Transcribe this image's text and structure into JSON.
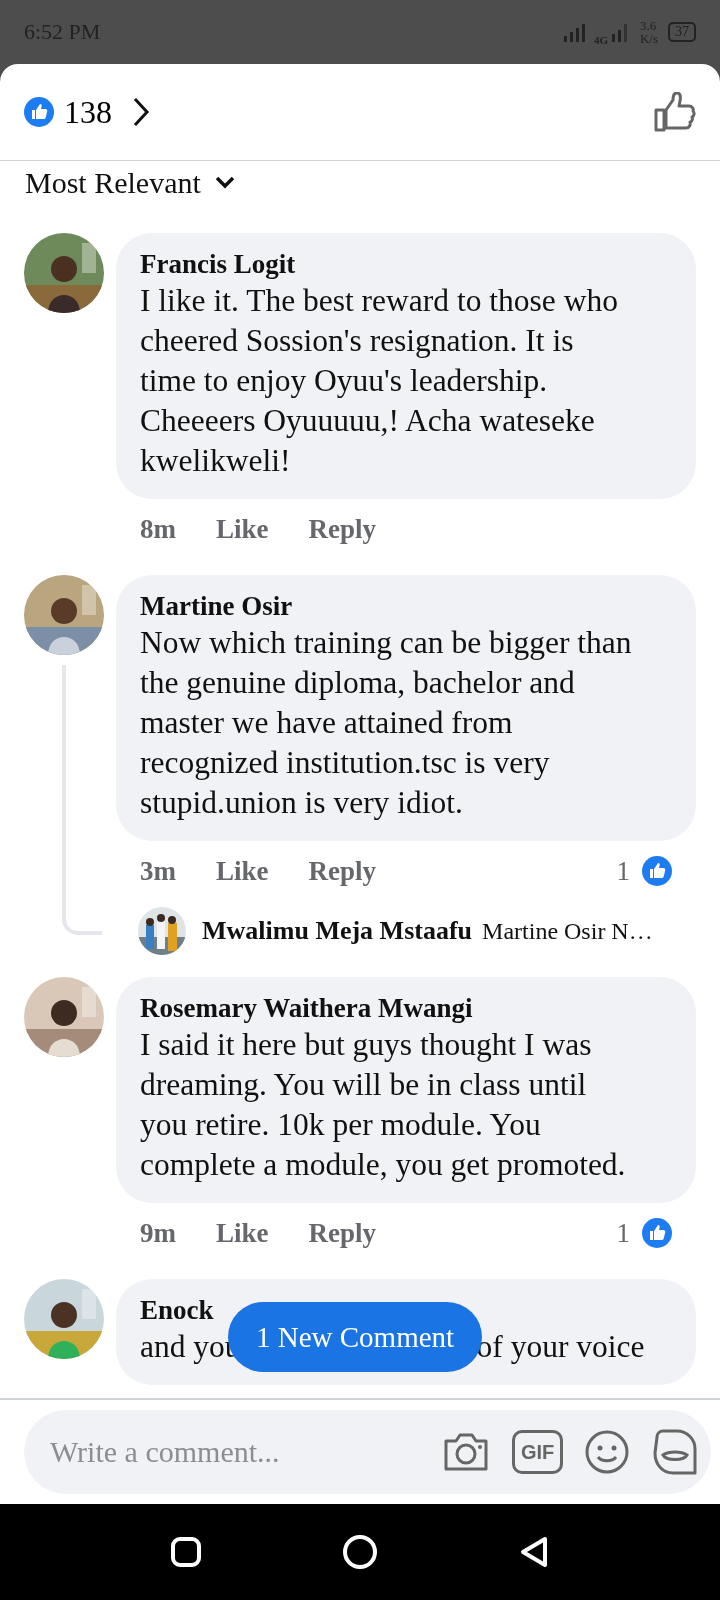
{
  "status_bar": {
    "time": "6:52 PM",
    "network": "4G",
    "speed": "3.6",
    "speed_unit": "K/s",
    "battery": "37"
  },
  "header": {
    "reaction_count": "138"
  },
  "sort": {
    "label": "Most Relevant"
  },
  "comments": [
    {
      "author": "Francis Logit",
      "text": "I like it. The best reward to those who cheered Sossion's resignation. It is time to enjoy Oyuu's leadership. Cheeeers Oyuuuuu,! Acha wateseke kwelikweli!",
      "time": "8m",
      "like": "Like",
      "reply": "Reply"
    },
    {
      "author": "Martine Osir",
      "text": "Now which training can be bigger than the genuine diploma, bachelor and master we have attained from recognized institution.tsc is very stupid.union is very idiot.",
      "time": "3m",
      "like": "Like",
      "reply": "Reply",
      "reactions": "1",
      "reply_preview": {
        "author": "Mwalimu Meja Mstaafu",
        "snippet": "Martine Osir N…"
      }
    },
    {
      "author": "Rosemary Waithera Mwangi",
      "text": "I said it here but guys thought I was dreaming. You will be in class until you retire. 10k per module. You complete a module, you get promoted.",
      "time": "9m",
      "like": "Like",
      "reply": "Reply",
      "reactions": "1"
    },
    {
      "author": "Enock",
      "text_parts": [
        "and you",
        "of your voice"
      ]
    }
  ],
  "new_comment_button": "1 New Comment",
  "composer": {
    "placeholder": "Write a comment...",
    "gif_label": "GIF"
  }
}
